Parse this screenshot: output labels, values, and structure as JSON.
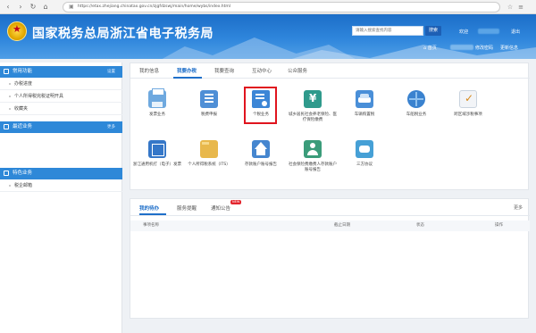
{
  "browser": {
    "url": "https://etax.zhejiang.chinatax.gov.cn/zjgfdzswj/main/home/wybs/index.html"
  },
  "header": {
    "site_title": "国家税务总局浙江省电子税务局",
    "search_placeholder": "请输入搜索查找内容",
    "search_label": "搜索",
    "welcome": "欢迎",
    "logout": "退出",
    "home": "首页",
    "change_password": "修改密码",
    "update_info": "更新信息"
  },
  "sidebar": {
    "sections": [
      {
        "title": "常用功能",
        "more": "设置",
        "items": [
          "办税进度",
          "个人所得税完税证明开具",
          "收藏夹"
        ]
      },
      {
        "title": "最近业务",
        "more": "更多",
        "items": []
      },
      {
        "title": "特色业务",
        "more": "",
        "items": [
          "税企邮箱"
        ]
      }
    ]
  },
  "main": {
    "tabs": [
      "我的信息",
      "我要办税",
      "我要查询",
      "互动中心",
      "公众服务"
    ],
    "active_tab": 1,
    "tiles": [
      {
        "label": "发票业务",
        "icon": "printer-icon"
      },
      {
        "label": "税费申报",
        "icon": "document-icon"
      },
      {
        "label": "个税业务",
        "icon": "personal-tax-icon"
      },
      {
        "label": "城乡居民社会养老保险、医疗保险缴费",
        "icon": "money-icon"
      },
      {
        "label": "车辆购置税",
        "icon": "car-icon"
      },
      {
        "label": "车船税业务",
        "icon": "globe-icon"
      },
      {
        "label": "跨区域涉税事项",
        "icon": "checklist-icon"
      },
      {
        "label": "浙江通用机打（电子）发票",
        "icon": "invoice-icon"
      },
      {
        "label": "个人所得税系统（ITS）",
        "icon": "folder-icon"
      },
      {
        "label": "存款账户账号报告",
        "icon": "bank-icon"
      },
      {
        "label": "社会保险费缴费人存款账户账号报告",
        "icon": "social-insurance-icon"
      },
      {
        "label": "三方协议",
        "icon": "handshake-icon"
      }
    ]
  },
  "tasks": {
    "tabs": [
      "我的待办",
      "服务提醒",
      "通知公告"
    ],
    "badge": "NEW",
    "more": "更多",
    "columns": [
      "事项名称",
      "截止日期",
      "状态",
      "操作"
    ]
  }
}
